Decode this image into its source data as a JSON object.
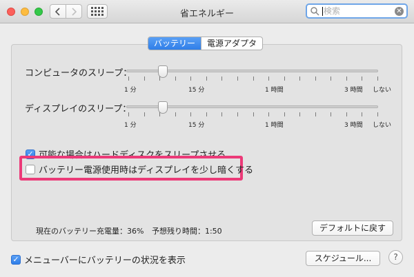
{
  "window": {
    "title": "省エネルギー",
    "search_placeholder": "検索"
  },
  "tabs": [
    {
      "label": "バッテリー",
      "active": true
    },
    {
      "label": "電源アダプタ",
      "active": false
    }
  ],
  "sliders": [
    {
      "label": "コンピュータのスリープ：",
      "value": "15 分",
      "ticks": [
        "1 分",
        "15 分",
        "1 時間",
        "3 時間",
        "しない"
      ]
    },
    {
      "label": "ディスプレイのスリープ：",
      "value": "15 分",
      "ticks": [
        "1 分",
        "15 分",
        "1 時間",
        "3 時間",
        "しない"
      ]
    }
  ],
  "options": [
    {
      "label": "可能な場合はハードディスクをスリープさせる",
      "checked": true
    },
    {
      "label": "バッテリー電源使用時はディスプレイを少し暗くする",
      "checked": false
    }
  ],
  "status": {
    "charge": "現在のバッテリー充電量：36%",
    "remaining": "予想残り時間：1:50"
  },
  "buttons": {
    "defaults": "デフォルトに戻す",
    "schedule": "スケジュール...",
    "help": "?"
  },
  "menubar_option": {
    "label": "メニューバーにバッテリーの状況を表示",
    "checked": true
  },
  "colors": {
    "accent": "#3a86ee",
    "highlight": "#ec3a78"
  }
}
